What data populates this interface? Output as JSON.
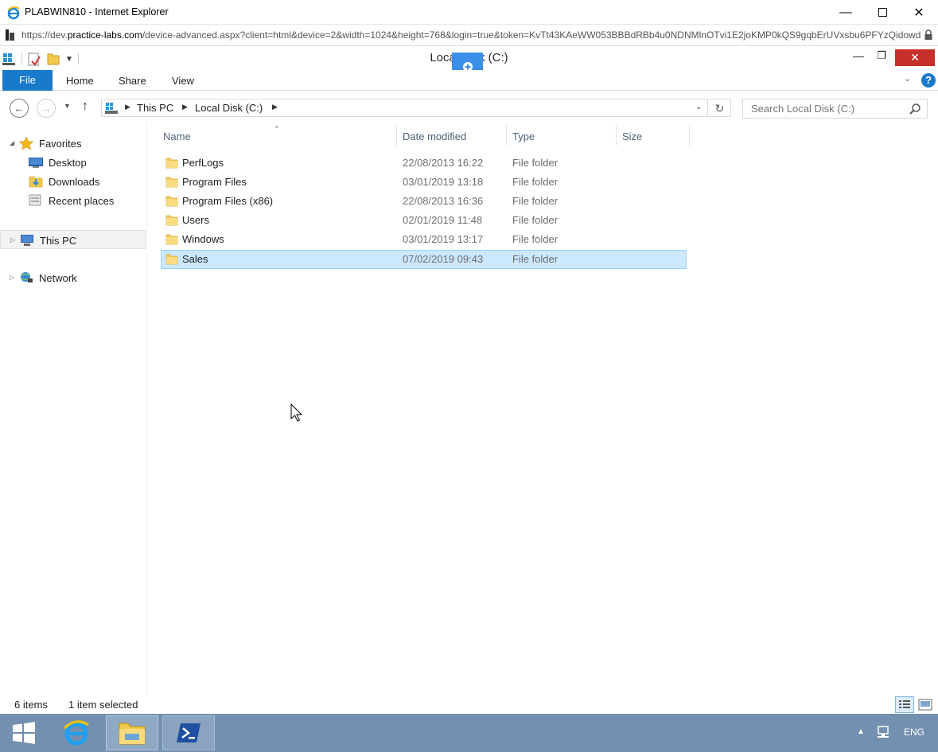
{
  "browser": {
    "title": "PLABWIN810 - Internet Explorer",
    "url_prefix": "https://dev.",
    "url_domain": "practice-labs.com",
    "url_rest": "/device-advanced.aspx?client=html&device=2&width=1024&height=768&login=true&token=KvTt43KAeWW053BBBdRBb4u0NDNMlnOTvi1E2joKMP0kQS9gqbErUVxsbu6PFYzQidowdX"
  },
  "explorer": {
    "title": "Local Disk (C:)",
    "ribbon_tabs": [
      "File",
      "Home",
      "Share",
      "View"
    ],
    "breadcrumb": [
      "This PC",
      "Local Disk (C:)"
    ],
    "search_placeholder": "Search Local Disk (C:)"
  },
  "nav": {
    "favorites": "Favorites",
    "favorite_items": [
      "Desktop",
      "Downloads",
      "Recent places"
    ],
    "this_pc": "This PC",
    "network": "Network"
  },
  "columns": {
    "name": "Name",
    "date": "Date modified",
    "type": "Type",
    "size": "Size"
  },
  "files": [
    {
      "name": "PerfLogs",
      "date": "22/08/2013 16:22",
      "type": "File folder"
    },
    {
      "name": "Program Files",
      "date": "03/01/2019 13:18",
      "type": "File folder"
    },
    {
      "name": "Program Files (x86)",
      "date": "22/08/2013 16:36",
      "type": "File folder"
    },
    {
      "name": "Users",
      "date": "02/01/2019 11:48",
      "type": "File folder"
    },
    {
      "name": "Windows",
      "date": "03/01/2019 13:17",
      "type": "File folder"
    },
    {
      "name": "Sales",
      "date": "07/02/2019 09:43",
      "type": "File folder"
    }
  ],
  "status": {
    "count": "6 items",
    "selected": "1 item selected"
  },
  "tray": {
    "language": "ENG"
  },
  "colors": {
    "file_tab": "#1979ca",
    "selection": "#cce8ff",
    "taskbar": "#7390b0",
    "close": "#c7302a"
  }
}
